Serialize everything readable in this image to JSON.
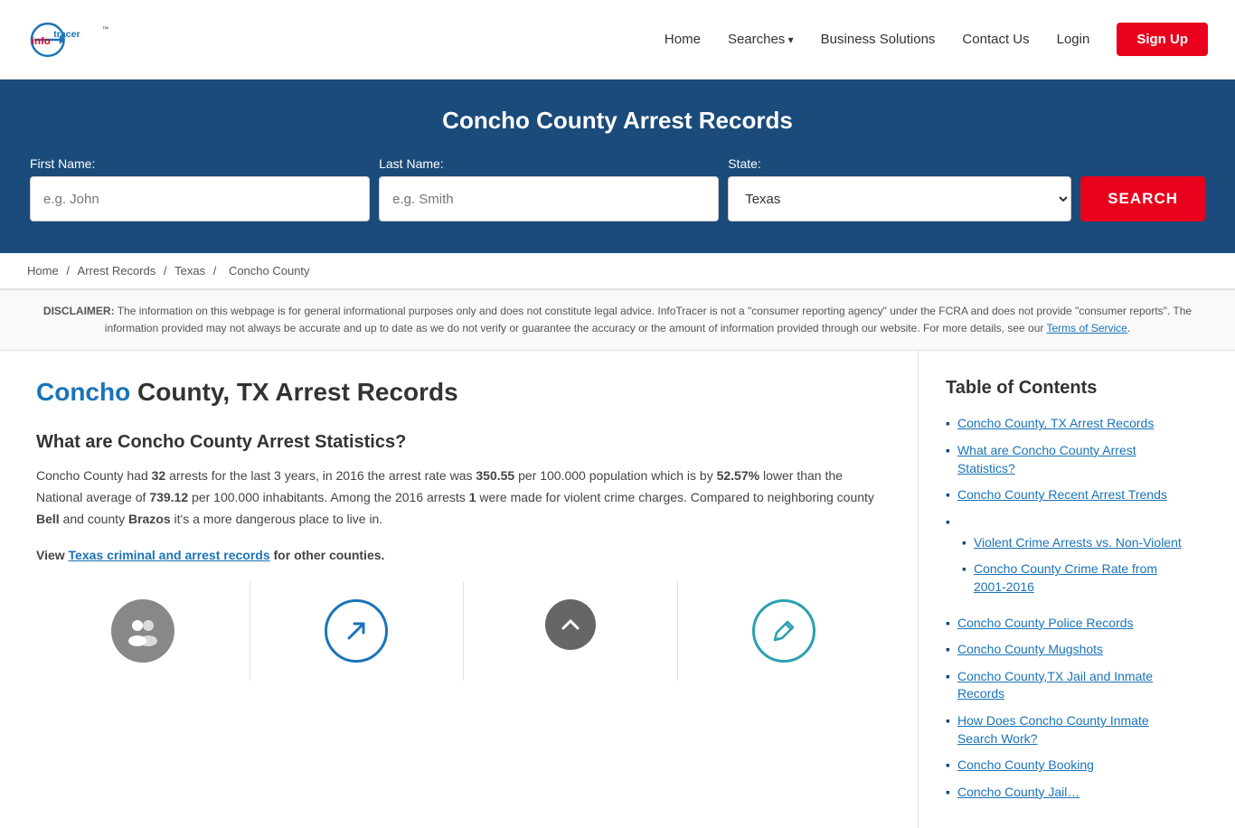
{
  "header": {
    "logo_alt": "InfoTracer",
    "nav": {
      "home": "Home",
      "searches": "Searches",
      "business_solutions": "Business Solutions",
      "contact_us": "Contact Us",
      "login": "Login",
      "signup": "Sign Up"
    }
  },
  "hero": {
    "title": "Concho County Arrest Records",
    "first_name_label": "First Name:",
    "first_name_placeholder": "e.g. John",
    "last_name_label": "Last Name:",
    "last_name_placeholder": "e.g. Smith",
    "state_label": "State:",
    "state_value": "Texas",
    "search_button": "SEARCH"
  },
  "breadcrumb": {
    "home": "Home",
    "arrest_records": "Arrest Records",
    "texas": "Texas",
    "concho_county": "Concho County"
  },
  "disclaimer": {
    "prefix": "DISCLAIMER:",
    "text": "The information on this webpage is for general informational purposes only and does not constitute legal advice. InfoTracer is not a \"consumer reporting agency\" under the FCRA and does not provide \"consumer reports\". The information provided may not always be accurate and up to date as we do not verify or guarantee the accuracy or the amount of information provided through our website. For more details, see our",
    "tos_link": "Terms of Service",
    "period": "."
  },
  "article": {
    "heading_highlight": "Concho",
    "heading_rest": " County, TX Arrest Records",
    "stats_heading": "What are Concho County Arrest Statistics?",
    "stats_p1_pre": "Concho County had ",
    "stats_p1_arrests": "32",
    "stats_p1_mid1": " arrests for the last 3 years, in 2016 the arrest rate was ",
    "stats_p1_rate": "350.55",
    "stats_p1_mid2": " per 100.000 population which is by ",
    "stats_p1_lower": "52.57%",
    "stats_p1_mid3": " lower than the National average of ",
    "stats_p1_national": "739.12",
    "stats_p1_mid4": " per 100.000 inhabitants. Among the 2016 arrests ",
    "stats_p1_violent": "1",
    "stats_p1_end": " were made for violent crime charges. Compared to neighboring county ",
    "stats_p1_bell": "Bell",
    "stats_p1_mid5": " and county ",
    "stats_p1_brazos": "Brazos",
    "stats_p1_last": " it's a more dangerous place to live in.",
    "view_line_pre": "View ",
    "view_link": "Texas criminal and arrest records",
    "view_line_post": " for other counties."
  },
  "toc": {
    "title": "Table of Contents",
    "items": [
      {
        "label": "Concho County, TX Arrest Records",
        "sub": false
      },
      {
        "label": "What are Concho County Arrest Statistics?",
        "sub": false
      },
      {
        "label": "Concho County Recent Arrest Trends",
        "sub": false
      },
      {
        "label": "Violent Crime Arrests vs. Non-Violent",
        "sub": true
      },
      {
        "label": "Concho County Crime Rate from 2001-2016",
        "sub": true
      },
      {
        "label": "Concho County Police Records",
        "sub": false
      },
      {
        "label": "Concho County Mugshots",
        "sub": false
      },
      {
        "label": "Concho County,TX Jail and Inmate Records",
        "sub": false
      },
      {
        "label": "How Does Concho County Inmate Search Work?",
        "sub": false
      },
      {
        "label": "Concho County Booking",
        "sub": false
      },
      {
        "label": "Concho County Jail…",
        "sub": false
      }
    ]
  },
  "icons": [
    {
      "symbol": "👥",
      "style": "grey"
    },
    {
      "symbol": "↗",
      "style": "blue-outline"
    },
    {
      "symbol": "▲",
      "style": "scroll-top"
    },
    {
      "symbol": "✏",
      "style": "teal"
    }
  ]
}
